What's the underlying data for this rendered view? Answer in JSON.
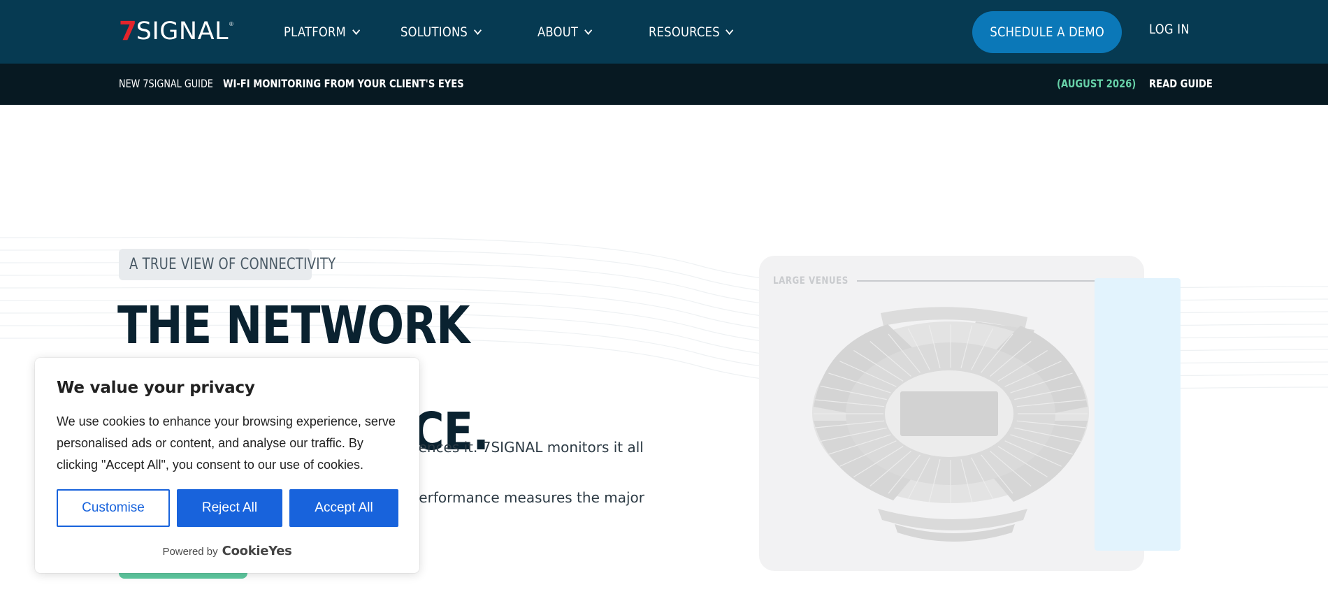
{
  "header": {
    "logo": {
      "seven": "7",
      "word": "SIGNAL",
      "mark": "®"
    },
    "nav": [
      {
        "label": "PLATFORM"
      },
      {
        "label": "SOLUTIONS"
      },
      {
        "label": "ABOUT"
      },
      {
        "label": "RESOURCES"
      }
    ],
    "demo_label": "SCHEDULE A DEMO",
    "login_label": "LOG IN"
  },
  "announcement": {
    "kicker": "NEW 7SIGNAL GUIDE",
    "title": "WI-FI MONITORING FROM YOUR CLIENT'S EYES",
    "date": "(AUGUST 2026)",
    "link": "READ GUIDE"
  },
  "hero": {
    "eyebrow": "A TRUE VIEW OF CONNECTIVITY",
    "headline_line1": "THE NETWORK STARTS",
    "headline_line2": "AT THE DEVICE.",
    "lede_line1": "Wi-Fi is only as good as each device experiences it. 7SIGNAL monitors it all outside-in,",
    "lede_line2": "giving you visibility into connectivity and performance measures the major vendors never built"
  },
  "venue_card": {
    "label": "LARGE VENUES"
  },
  "cookie_banner": {
    "title": "We value your privacy",
    "body": "We use cookies to enhance your browsing experience, serve personalised ads or content, and analyse our traffic. By clicking \"Accept All\", you consent to our use of cookies.",
    "customise_label": "Customise",
    "reject_label": "Reject All",
    "accept_label": "Accept All",
    "powered_by": "Powered by",
    "brand": "CookieYes"
  },
  "colors": {
    "nav_bg": "#063a52",
    "announce_bg": "#071922",
    "accent_blue": "#0b78b8",
    "accent_green": "#67d1a8",
    "cookie_blue": "#1863dc",
    "logo_red": "#e3242b"
  },
  "icons": {
    "nav_chevron": "chevron-down-icon",
    "stadium": "stadium-map-icon"
  }
}
